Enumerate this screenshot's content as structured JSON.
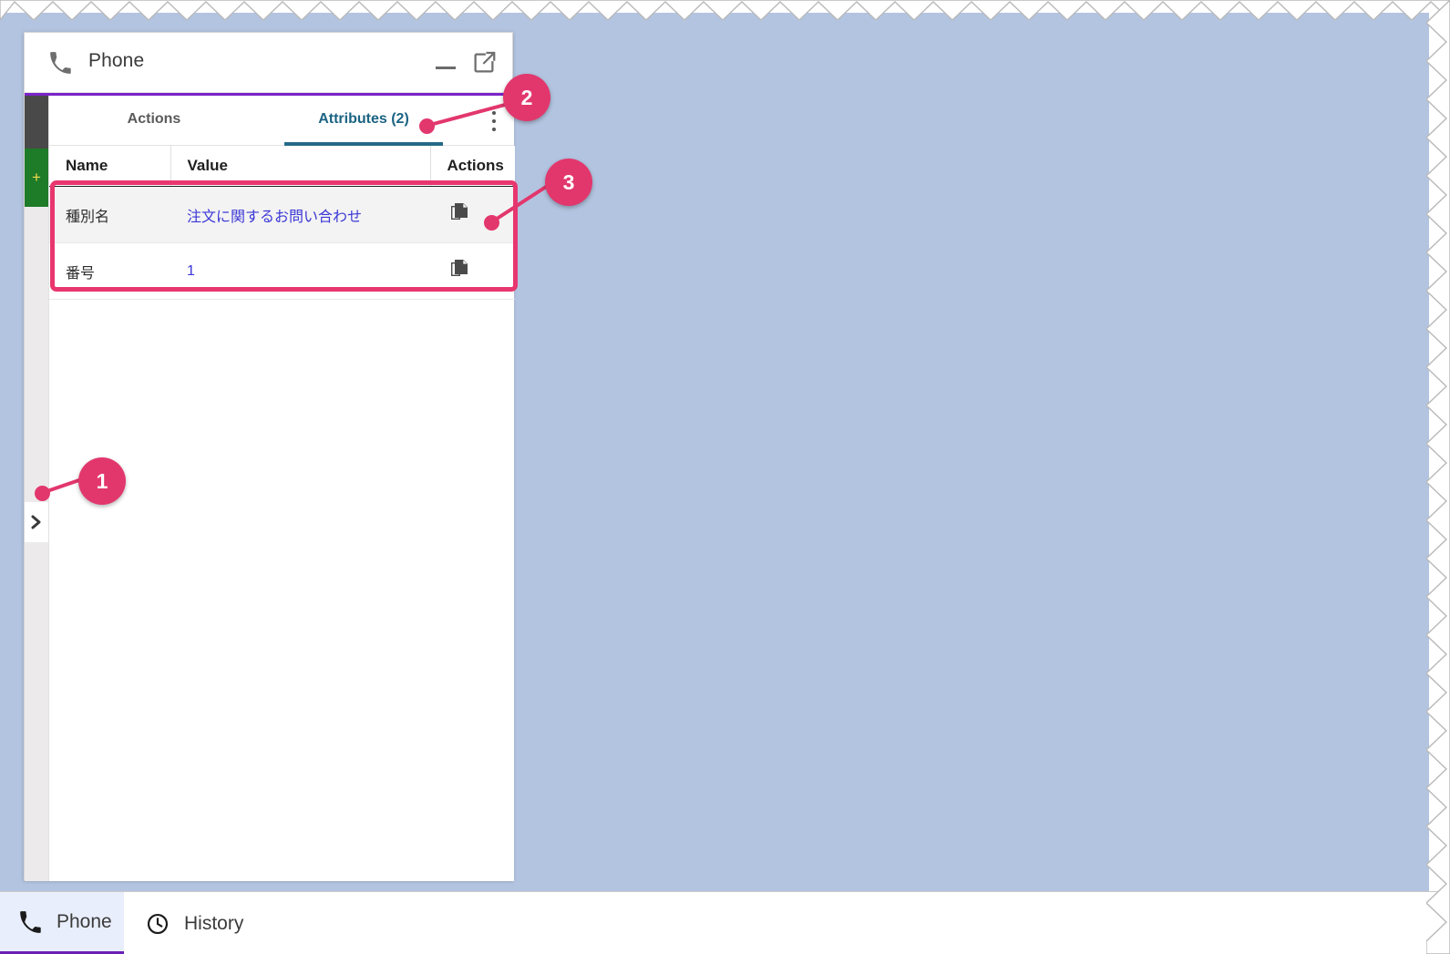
{
  "window": {
    "title": "Phone",
    "icon": "phone-icon",
    "minimize_label": "Minimize",
    "popout_label": "Pop out"
  },
  "left_rail": {
    "plus_label": "+",
    "expand_label": ">"
  },
  "tabs": [
    {
      "label": "Actions",
      "active": false
    },
    {
      "label": "Attributes (2)",
      "active": true
    }
  ],
  "overflow_menu_label": "More options",
  "table": {
    "headers": [
      "Name",
      "Value",
      "Actions"
    ],
    "rows": [
      {
        "name": "種別名",
        "value": "注文に関するお問い合わせ",
        "action_icon": "copy-icon"
      },
      {
        "name": "番号",
        "value": "1",
        "action_icon": "copy-icon"
      }
    ]
  },
  "taskbar": {
    "items": [
      {
        "label": "Phone",
        "icon": "phone-icon",
        "active": true
      },
      {
        "label": "History",
        "icon": "clock-icon",
        "active": false
      }
    ]
  },
  "annotations": {
    "callouts": [
      {
        "number": "1"
      },
      {
        "number": "2"
      },
      {
        "number": "3"
      }
    ]
  },
  "colors": {
    "accent_purple": "#7b23c9",
    "tab_active": "#1b6383",
    "value_link": "#3b37d6",
    "annotation": "#e2376d",
    "desktop_background": "#b3c4e0",
    "rail_green": "#1e7b28",
    "rail_dark": "#494949"
  }
}
